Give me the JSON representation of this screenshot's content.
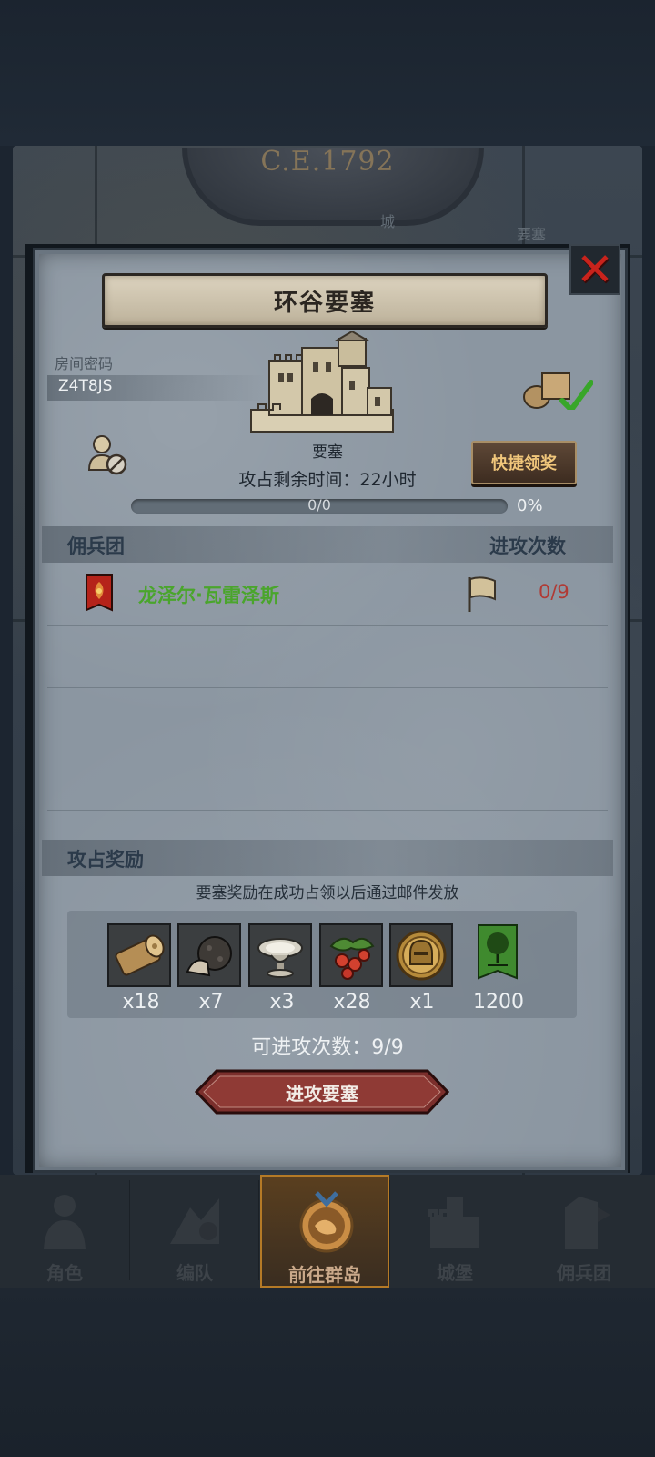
{
  "map": {
    "era": "C.E.1792",
    "labels": [
      "城",
      "要塞"
    ]
  },
  "dialog": {
    "title": "环谷要塞",
    "room_code_label": "房间密码",
    "room_code": "Z4T8JS",
    "fortress_type": "要塞",
    "time_remaining": "攻占剩余时间：22小时",
    "quick_claim_label": "快捷领奖",
    "progress": {
      "text": "0/0",
      "percent_label": "0%",
      "fraction": 0
    },
    "mercenary_header": "佣兵团",
    "attack_count_header": "进攻次数",
    "mercenaries": [
      {
        "name": "龙泽尔·瓦雷泽斯",
        "attacks": "0/9"
      }
    ],
    "rewards_header": "攻占奖励",
    "reward_note": "要塞奖励在成功占领以后通过邮件发放",
    "rewards": [
      {
        "icon": "wood-log-icon",
        "qty": "x18"
      },
      {
        "icon": "truffle-icon",
        "qty": "x7"
      },
      {
        "icon": "silver-dish-icon",
        "qty": "x3"
      },
      {
        "icon": "berries-icon",
        "qty": "x28"
      },
      {
        "icon": "knight-helmet-coin-icon",
        "qty": "x1"
      },
      {
        "icon": "tree-banner-icon",
        "qty": "1200"
      }
    ],
    "attacks_left": "可进攻次数：9/9",
    "attack_button_label": "进攻要塞"
  },
  "nav": {
    "items": [
      {
        "label": "角色",
        "icon": "character-icon"
      },
      {
        "label": "编队",
        "icon": "formation-icon"
      },
      {
        "label": "前往群岛",
        "icon": "islands-icon",
        "active": true
      },
      {
        "label": "城堡",
        "icon": "castle-icon"
      },
      {
        "label": "佣兵团",
        "icon": "mercenary-icon"
      }
    ]
  },
  "colors": {
    "panel": "#8b96a1",
    "accent_red": "#c8231c",
    "merc_green": "#4aa52c",
    "attack_red": "#b03a34",
    "quick_btn_text": "#f0c67b",
    "nav_active": "#b57a26"
  }
}
